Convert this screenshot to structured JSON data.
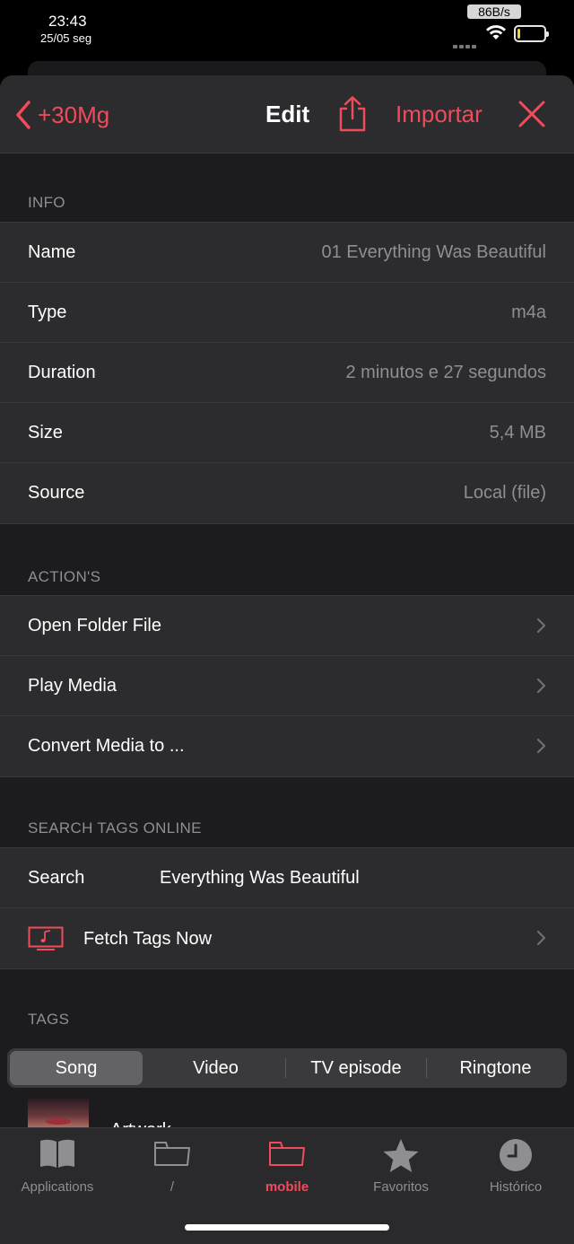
{
  "status_bar": {
    "time": "23:43",
    "date": "25/05 seg",
    "network_speed": "86B/s",
    "battery_level": 0.12
  },
  "navbar": {
    "back_label": "+30Mg",
    "title": "Edit",
    "import_label": "Importar"
  },
  "info": {
    "header": "INFO",
    "rows": [
      {
        "label": "Name",
        "value": "01 Everything Was Beautiful"
      },
      {
        "label": "Type",
        "value": "m4a"
      },
      {
        "label": "Duration",
        "value": "2 minutos e 27 segundos"
      },
      {
        "label": "Size",
        "value": "5,4 MB"
      },
      {
        "label": "Source",
        "value": "Local (file)"
      }
    ]
  },
  "actions": {
    "header": "ACTION'S",
    "rows": [
      {
        "label": "Open Folder File"
      },
      {
        "label": "Play Media"
      },
      {
        "label": "Convert Media to ..."
      }
    ]
  },
  "search_tags": {
    "header": "SEARCH TAGS ONLINE",
    "search_label": "Search",
    "search_value": "Everything Was Beautiful",
    "fetch_label": "Fetch Tags Now"
  },
  "tags": {
    "header": "TAGS",
    "segments": [
      "Song",
      "Video",
      "TV episode",
      "Ringtone"
    ],
    "selected_segment": "Song",
    "artwork_label": "Artwork"
  },
  "tabbar": {
    "items": [
      {
        "label": "Applications",
        "icon": "book-icon"
      },
      {
        "label": "/",
        "icon": "folder-icon"
      },
      {
        "label": "mobile",
        "icon": "folder-icon"
      },
      {
        "label": "Favoritos",
        "icon": "star-icon"
      },
      {
        "label": "Histórico",
        "icon": "clock-icon"
      }
    ],
    "active": "mobile"
  },
  "colors": {
    "accent": "#ef4b5c",
    "cell_background": "#2c2c2e",
    "page_background": "#1c1c1e",
    "secondary_text": "#8e8e93"
  }
}
